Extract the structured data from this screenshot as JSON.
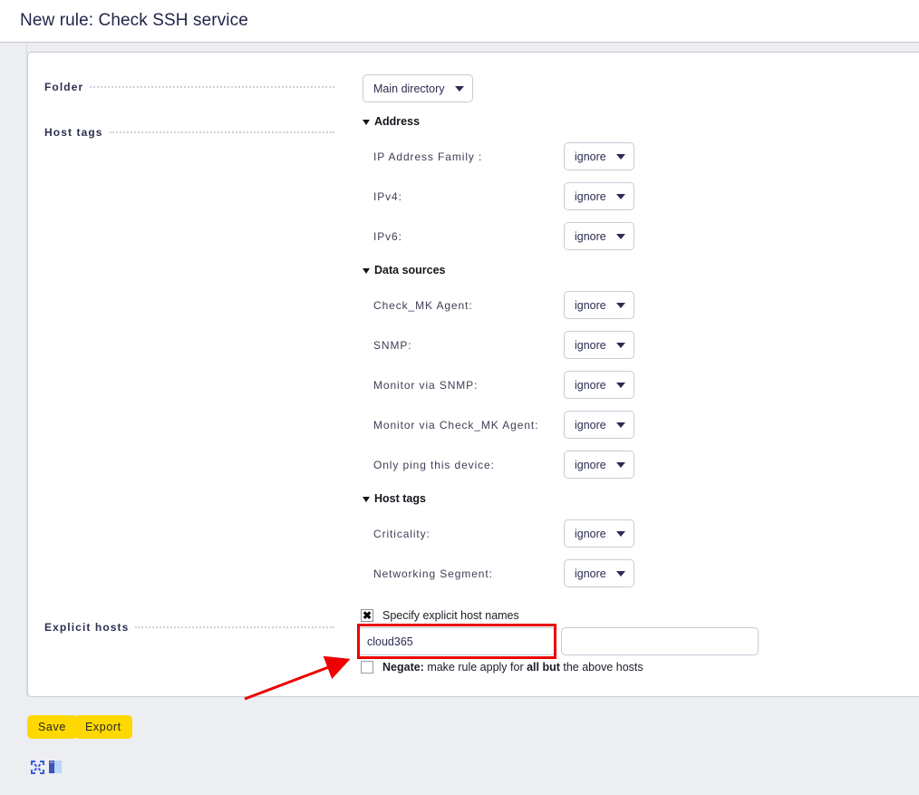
{
  "window": {
    "title": "New rule: Check SSH service"
  },
  "form": {
    "rows": [
      {
        "label": "Folder"
      },
      {
        "label": "Host tags"
      },
      {
        "label": "Explicit hosts"
      }
    ],
    "folder": {
      "selected": "Main directory"
    },
    "sections": [
      {
        "name": "Address",
        "title": "Address",
        "items": [
          {
            "label": "IP Address Family :",
            "value": "ignore"
          },
          {
            "label": "IPv4:",
            "value": "ignore"
          },
          {
            "label": "IPv6:",
            "value": "ignore"
          }
        ]
      },
      {
        "name": "Data sources",
        "title": "Data sources",
        "items": [
          {
            "label": "Check_MK Agent:",
            "value": "ignore"
          },
          {
            "label": "SNMP:",
            "value": "ignore"
          },
          {
            "label": "Monitor via SNMP:",
            "value": "ignore"
          },
          {
            "label": "Monitor via Check_MK Agent:",
            "value": "ignore"
          },
          {
            "label": "Only ping this device:",
            "value": "ignore"
          }
        ]
      },
      {
        "name": "Host tags",
        "title": "Host tags",
        "items": [
          {
            "label": "Criticality:",
            "value": "ignore"
          },
          {
            "label": "Networking Segment:",
            "value": "ignore"
          }
        ]
      }
    ],
    "explicit_hosts": {
      "specify_checkbox": {
        "label": "Specify explicit host names",
        "checked": true,
        "mark": "✖"
      },
      "host_input_1": {
        "value": "cloud365",
        "placeholder": ""
      },
      "host_input_2": {
        "value": "",
        "placeholder": ""
      },
      "negate_checkbox": {
        "checked": false,
        "mark": ""
      },
      "negate_text": {
        "strong1": "Negate:",
        "mid": " make rule apply for ",
        "strong2": "all but",
        "tail": " the above hosts"
      }
    }
  },
  "footer": {
    "save_label": "Save",
    "export_label": "Export",
    "icons": [
      {
        "name": "expand-icon"
      },
      {
        "name": "layout-icon"
      }
    ]
  },
  "annotations": {
    "highlight_color": "#ee0000",
    "arrow_color": "#ee0000",
    "accent_button_color": "#ffd800"
  }
}
